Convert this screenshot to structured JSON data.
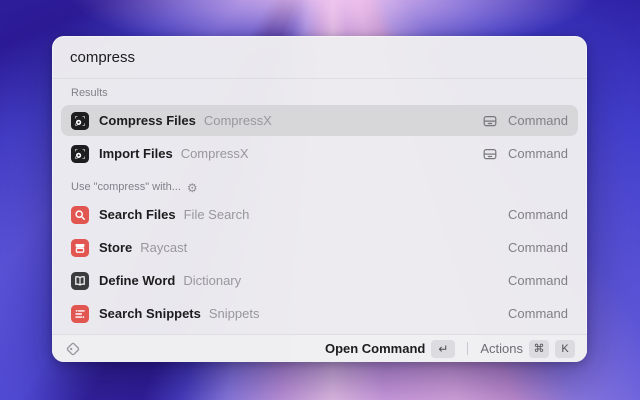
{
  "search": {
    "value": "compress"
  },
  "sections": {
    "results_label": "Results",
    "fallback_label": "Use \"compress\" with..."
  },
  "rows": [
    {
      "title": "Compress Files",
      "subtitle": "CompressX",
      "type": "Command",
      "icon": "compressx-app-icon",
      "accessory": "hard-drive-icon",
      "selected": true
    },
    {
      "title": "Import Files",
      "subtitle": "CompressX",
      "type": "Command",
      "icon": "compressx-app-icon",
      "accessory": "hard-drive-icon",
      "selected": false
    },
    {
      "title": "Search Files",
      "subtitle": "File Search",
      "type": "Command",
      "icon": "file-search-icon",
      "accessory": null,
      "selected": false
    },
    {
      "title": "Store",
      "subtitle": "Raycast",
      "type": "Command",
      "icon": "store-icon",
      "accessory": null,
      "selected": false
    },
    {
      "title": "Define Word",
      "subtitle": "Dictionary",
      "type": "Command",
      "icon": "dictionary-icon",
      "accessory": null,
      "selected": false
    },
    {
      "title": "Search Snippets",
      "subtitle": "Snippets",
      "type": "Command",
      "icon": "snippets-icon",
      "accessory": null,
      "selected": false
    }
  ],
  "footer": {
    "primary_label": "Open Command",
    "primary_key": "↵",
    "secondary_label": "Actions",
    "secondary_keys": [
      "⌘",
      "K"
    ]
  },
  "icons": {
    "gear": "⚙"
  },
  "colors": {
    "icon_red": "#e25652",
    "icon_dark": "#3b3b3e",
    "selection": "#d7d6d9",
    "window_bg": "#edecef",
    "wallpaper_deep": "#2c1b96",
    "wallpaper_pink": "#ecc6ec"
  }
}
